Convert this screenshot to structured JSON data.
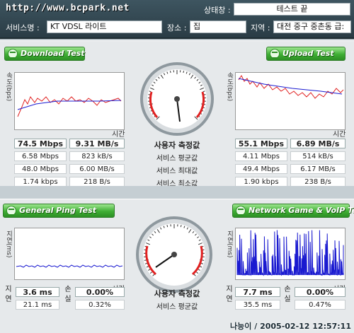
{
  "header": {
    "site": "http://www.bcpark.net",
    "status_label": "상태창 :",
    "status_value": "테스트 끝",
    "service_label": "서비스명 :",
    "service_value": "KT VDSL 라이트",
    "place_label": "장소 :",
    "place_value": "집",
    "region_label": "지역 :",
    "region_value": "대전 중구 중촌동 급:"
  },
  "download": {
    "button": "Download Test",
    "ylabel": "속도(bps)",
    "xlabel": "시간",
    "rows": [
      [
        "74.5 Mbps",
        "9.31 MB/s"
      ],
      [
        "6.58 Mbps",
        "823 kB/s"
      ],
      [
        "48.0 Mbps",
        "6.00 MB/s"
      ],
      [
        "1.74 kbps",
        "218 B/s"
      ]
    ]
  },
  "upload": {
    "button": "Upload Test",
    "ylabel": "속도(bps)",
    "xlabel": "시간",
    "rows": [
      [
        "55.1 Mbps",
        "6.89 MB/s"
      ],
      [
        "4.11 Mbps",
        "514 kB/s"
      ],
      [
        "49.4 Mbps",
        "6.17 MB/s"
      ],
      [
        "1.90 kbps",
        "238 B/s"
      ]
    ]
  },
  "middle1": {
    "labels": [
      "사용자 측정값",
      "서비스 평균값",
      "서비스 최대값",
      "서비스 최소값"
    ]
  },
  "ping": {
    "button": "General Ping Test",
    "ylabel": "지연(ms)",
    "xlabel": "시간",
    "side_a": [
      "지",
      "연"
    ],
    "rows": [
      [
        "3.6 ms"
      ],
      [
        "21.1 ms"
      ]
    ]
  },
  "game": {
    "button": "Network Game & VoIP Test",
    "ylabel": "지연(ms)",
    "xlabel": "시간",
    "side_b": [
      "손",
      "실"
    ],
    "rows": [
      [
        "7.7 ms",
        "0.00%"
      ],
      [
        "35.5 ms",
        "0.47%"
      ]
    ],
    "ping_loss": [
      "0.00%",
      "0.32%"
    ]
  },
  "middle2": {
    "labels": [
      "사용자 측정값",
      "서비스 평균값"
    ]
  },
  "footer": {
    "stamp": "나능이 / 2005-02-12 12:57:11"
  },
  "gauge_ticks": [
    "10k",
    "100k",
    "1M",
    "10M",
    "100M"
  ],
  "colors": {
    "accent_green": "#3fae34",
    "header_bg": "#2e414a",
    "trace_red": "#e02020",
    "trace_blue": "#1a1ad0"
  }
}
